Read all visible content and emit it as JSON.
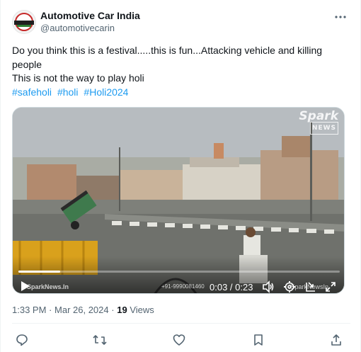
{
  "author": {
    "name": "Automotive Car India",
    "handle": "@automotivecarin",
    "avatar_icon": "automotive-car-india-logo"
  },
  "tweet": {
    "lines": [
      "Do you think this is a festival.....this is fun...Attacking vehicle and killing",
      "people",
      "This is not the way to play holi"
    ],
    "hashtags": [
      "#safeholi",
      "#holi",
      "#Holi2024"
    ]
  },
  "video": {
    "time_current": "0:03",
    "time_total": "0:23",
    "timecode": "0:03 / 0:23",
    "progress_fraction": 0.13,
    "brand": "Spark",
    "brand_sub": "NEWS",
    "watermark_left": "SparkNews.In",
    "watermark_mid": "+91-9990081460",
    "watermark_right": "/SparkNewsIn",
    "controls": [
      "play-icon",
      "volume-icon",
      "settings-icon",
      "pip-icon",
      "fullscreen-icon"
    ]
  },
  "meta": {
    "time": "1:33 PM",
    "date": "Mar 26, 2024",
    "views": "19",
    "views_label": "Views",
    "separator": "·"
  },
  "actions": [
    "reply-icon",
    "retweet-icon",
    "like-icon",
    "bookmark-icon",
    "share-icon"
  ],
  "colors": {
    "link": "#1d9bf0",
    "text": "#0f1419",
    "secondary": "#536471"
  }
}
